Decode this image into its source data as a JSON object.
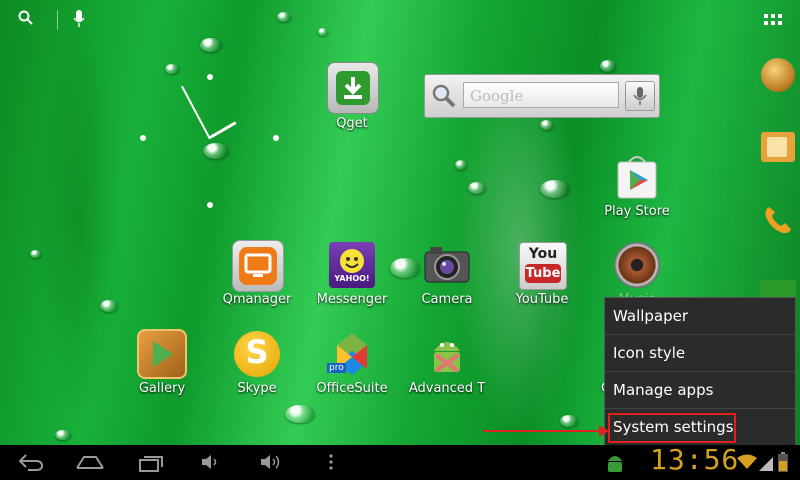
{
  "top_bar": {
    "search_icon": "search-icon",
    "voice_icon": "mic-icon",
    "apps_icon": "all-apps-grid-icon"
  },
  "google_widget": {
    "placeholder": "Google"
  },
  "apps": {
    "qget": "Qget",
    "play_store": "Play Store",
    "qmanager": "Qmanager",
    "messenger": "Messenger",
    "camera": "Camera",
    "youtube": "YouTube",
    "music": "Music",
    "gallery": "Gallery",
    "skype": "Skype",
    "officesuite": "OfficeSuite",
    "advanced": "Advanced T",
    "partial_c": "C"
  },
  "badges": {
    "yahoo": "YAHOO!",
    "pro": "pro",
    "you": "You",
    "tube": "Tube"
  },
  "menu": {
    "items": [
      "Wallpaper",
      "Icon style",
      "Manage apps",
      "System settings"
    ]
  },
  "status_bar": {
    "time": "13:56"
  },
  "colors": {
    "accent_clock": "#d4a020",
    "highlight": "#dd2222"
  }
}
